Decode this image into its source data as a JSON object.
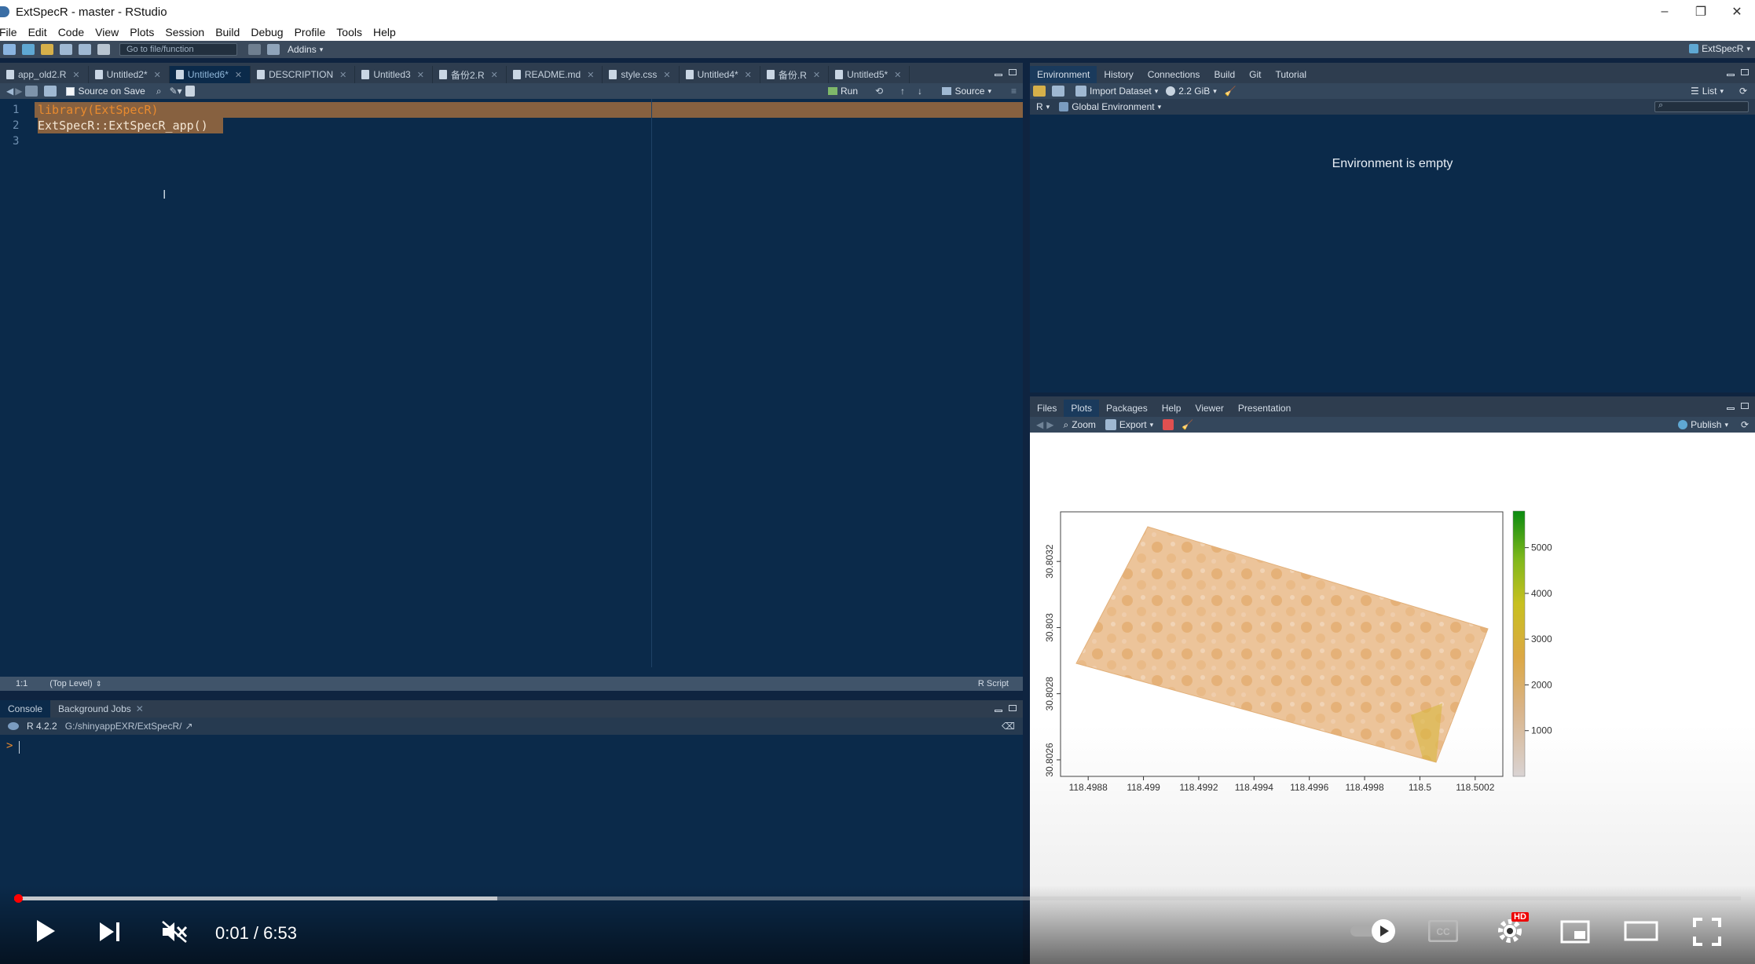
{
  "window": {
    "title": "ExtSpecR - master - RStudio",
    "controls": [
      "–",
      "❐",
      "✕"
    ]
  },
  "menu": [
    "File",
    "Edit",
    "Code",
    "View",
    "Plots",
    "Session",
    "Build",
    "Debug",
    "Profile",
    "Tools",
    "Help"
  ],
  "toolbar": {
    "goto_placeholder": "Go to file/function",
    "addins": "Addins",
    "project": "ExtSpecR"
  },
  "editor": {
    "tabs": [
      {
        "label": "app_old2.R",
        "active": false
      },
      {
        "label": "Untitled2*",
        "active": false
      },
      {
        "label": "Untitled6*",
        "active": true
      },
      {
        "label": "DESCRIPTION",
        "active": false
      },
      {
        "label": "Untitled3",
        "active": false
      },
      {
        "label": "备份2.R",
        "active": false
      },
      {
        "label": "README.md",
        "active": false
      },
      {
        "label": "style.css",
        "active": false
      },
      {
        "label": "Untitled4*",
        "active": false
      },
      {
        "label": "备份.R",
        "active": false
      },
      {
        "label": "Untitled5*",
        "active": false
      }
    ],
    "source_on_save": "Source on Save",
    "run": "Run",
    "source": "Source",
    "lines": [
      {
        "num": "1",
        "text": "library(ExtSpecR)"
      },
      {
        "num": "2",
        "text": "ExtSpecR::ExtSpecR_app()"
      },
      {
        "num": "3",
        "text": ""
      }
    ],
    "status_pos": "1:1",
    "status_scope": "(Top Level)",
    "status_type": "R Script"
  },
  "console": {
    "tabs": [
      "Console",
      "Background Jobs"
    ],
    "r_version": "R 4.2.2",
    "path": "G:/shinyappEXR/ExtSpecR/",
    "prompt": ">"
  },
  "environment": {
    "tabs": [
      "Environment",
      "History",
      "Connections",
      "Build",
      "Git",
      "Tutorial"
    ],
    "import_dataset": "Import Dataset",
    "memory": "2.2 GiB",
    "list_view": "List",
    "language": "R",
    "scope": "Global Environment",
    "empty_message": "Environment is empty"
  },
  "plots": {
    "tabs": [
      "Files",
      "Plots",
      "Packages",
      "Help",
      "Viewer",
      "Presentation"
    ],
    "zoom": "Zoom",
    "export": "Export",
    "publish": "Publish"
  },
  "chart_data": {
    "type": "heatmap",
    "title": "",
    "xlabel": "",
    "ylabel": "",
    "x_ticks": [
      "118.4988",
      "118.499",
      "118.4992",
      "118.4994",
      "118.4996",
      "118.4998",
      "118.5",
      "118.5002"
    ],
    "y_ticks": [
      "30.8026",
      "30.8028",
      "30.803",
      "30.8032"
    ],
    "legend_ticks": [
      "1000",
      "2000",
      "3000",
      "4000",
      "5000"
    ],
    "legend_colors": [
      "#d9d3d3",
      "#d9b48a",
      "#dca845",
      "#c8c020",
      "#7fb81c",
      "#0a8a10"
    ],
    "xlim": [
      118.4987,
      118.5003
    ],
    "ylim": [
      30.80255,
      30.80335
    ]
  },
  "player": {
    "time": "0:01 / 6:53",
    "hd_badge": "HD",
    "played_fraction": 0.0025,
    "buffered_fraction": 0.28
  }
}
